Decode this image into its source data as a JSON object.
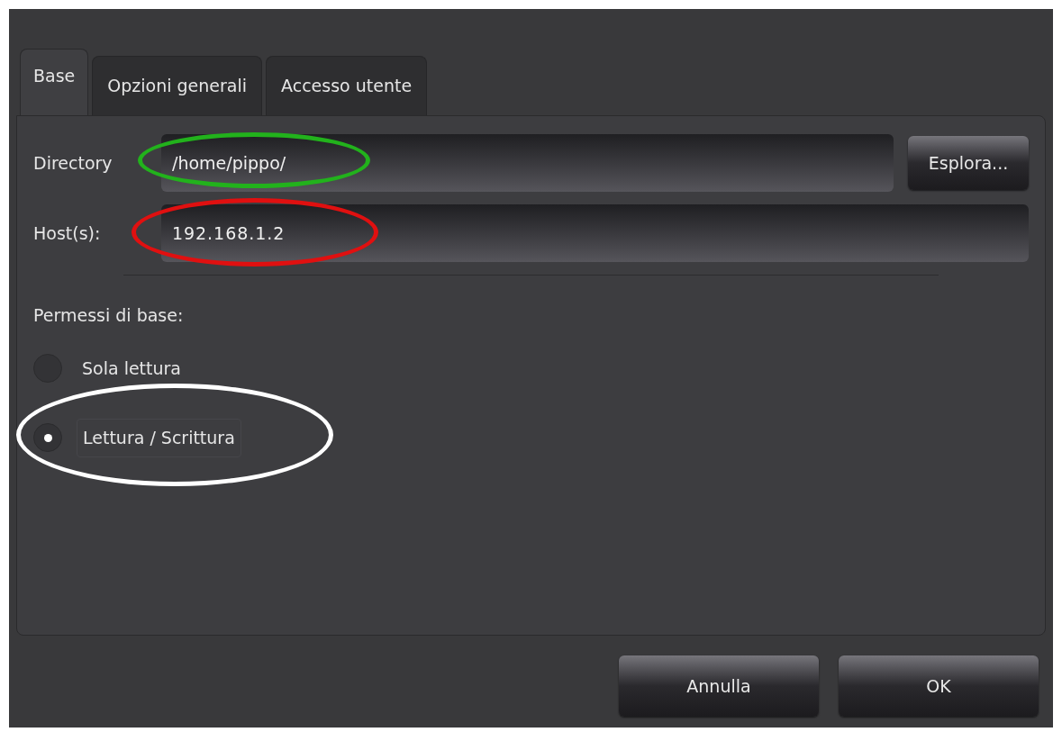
{
  "tabs": [
    {
      "label": "Base",
      "selected": true
    },
    {
      "label": "Opzioni generali",
      "selected": false
    },
    {
      "label": "Accesso utente",
      "selected": false
    }
  ],
  "directory": {
    "label": "Directory",
    "value": "/home/pippo/",
    "button": "Esplora..."
  },
  "hosts": {
    "label": "Host(s):",
    "value": "192.168.1.2"
  },
  "permissions": {
    "label": "Permessi di base:",
    "options": [
      {
        "label": "Sola lettura",
        "selected": false
      },
      {
        "label": "Lettura / Scrittura",
        "selected": true
      }
    ]
  },
  "buttons": [
    "Annulla",
    "OK"
  ],
  "annotations": [
    {
      "color": "#22b21c"
    },
    {
      "color": "#e01010"
    },
    {
      "color": "#ffffff"
    }
  ]
}
